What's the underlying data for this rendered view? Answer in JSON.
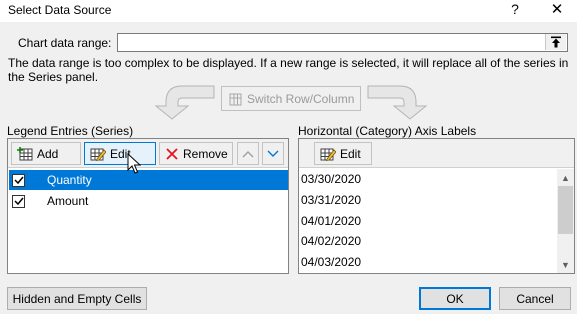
{
  "window": {
    "title": "Select Data Source",
    "help_glyph": "?",
    "close_glyph": "✕"
  },
  "chart_data_range": {
    "label": "Chart data range:",
    "value": "",
    "collapse_icon": "range-select-icon"
  },
  "message": "The data range is too complex to be displayed. If a new range is selected, it will replace all of the series in the Series panel.",
  "switch_button": {
    "label": "Switch Row/Column",
    "enabled": false
  },
  "legend_entries": {
    "label": "Legend Entries (Series)",
    "toolbar": {
      "add_label": "Add",
      "edit_label": "Edit",
      "remove_label": "Remove"
    },
    "series": [
      {
        "name": "Quantity",
        "checked": true,
        "selected": true
      },
      {
        "name": "Amount",
        "checked": true,
        "selected": false
      }
    ]
  },
  "axis_labels": {
    "label": "Horizontal (Category) Axis Labels",
    "toolbar": {
      "edit_label": "Edit"
    },
    "items": [
      "03/30/2020",
      "03/31/2020",
      "04/01/2020",
      "04/02/2020",
      "04/03/2020"
    ]
  },
  "footer": {
    "hidden_empty_label": "Hidden and Empty Cells",
    "ok_label": "OK",
    "cancel_label": "Cancel"
  },
  "colors": {
    "selection": "#0078d7",
    "remove_icon": "#e81123",
    "dialog_bg": "#f0f0f0"
  }
}
